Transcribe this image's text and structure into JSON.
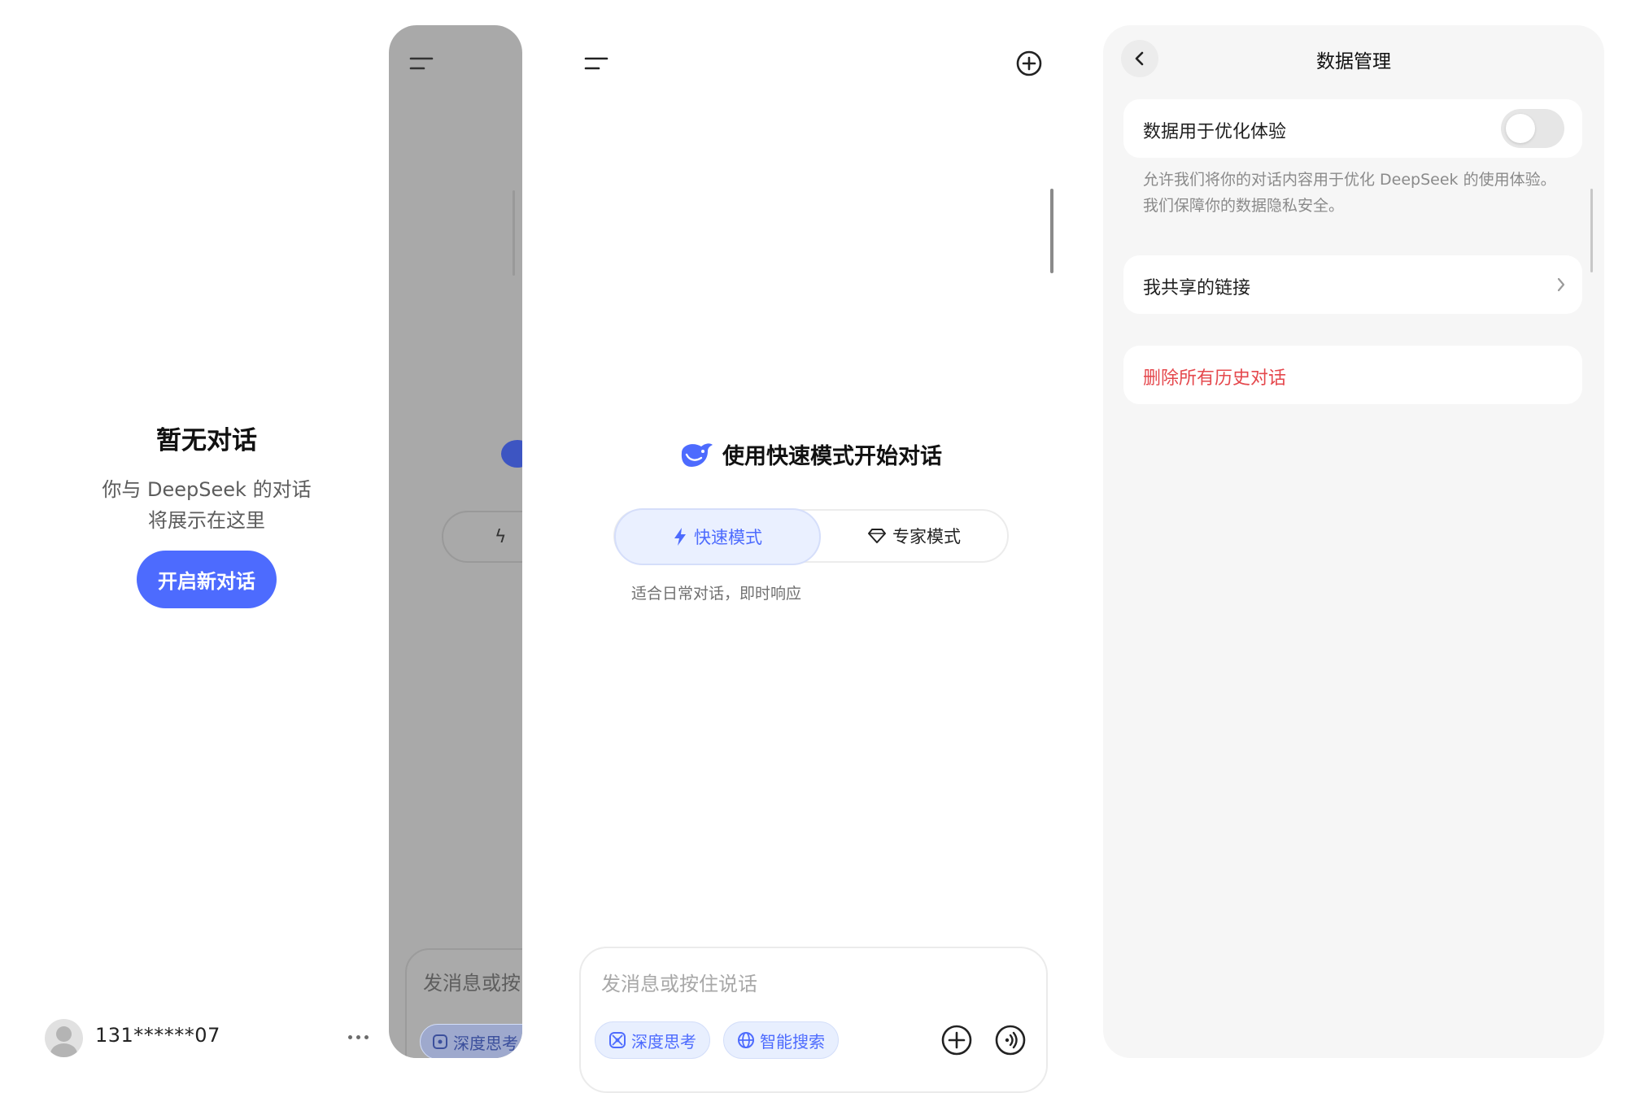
{
  "sidebar": {
    "empty_title": "暂无对话",
    "empty_desc_line1": "你与 DeepSeek 的对话",
    "empty_desc_line2": "将展示在这里",
    "new_chat_label": "开启新对话",
    "user_name": "131******07"
  },
  "peek": {
    "input_placeholder": "发消息或按",
    "chip_label": "深度思考"
  },
  "chat": {
    "welcome_text": "使用快速模式开始对话",
    "modes": {
      "fast_label": "快速模式",
      "expert_label": "专家模式",
      "selected": "快速模式"
    },
    "mode_description": "适合日常对话，即时响应",
    "input_placeholder": "发消息或按住说话",
    "chips": {
      "deep_think": "深度思考",
      "smart_search": "智能搜索"
    }
  },
  "settings": {
    "title": "数据管理",
    "optimize_label": "数据用于优化体验",
    "optimize_enabled": false,
    "optimize_desc": "允许我们将你的对话内容用于优化 DeepSeek 的使用体验。我们保障你的数据隐私安全。",
    "shared_links_label": "我共享的链接",
    "delete_all_label": "删除所有历史对话"
  },
  "colors": {
    "accent": "#4d6bfe",
    "danger": "#e5484d",
    "overlay": "#a9a9a9"
  }
}
